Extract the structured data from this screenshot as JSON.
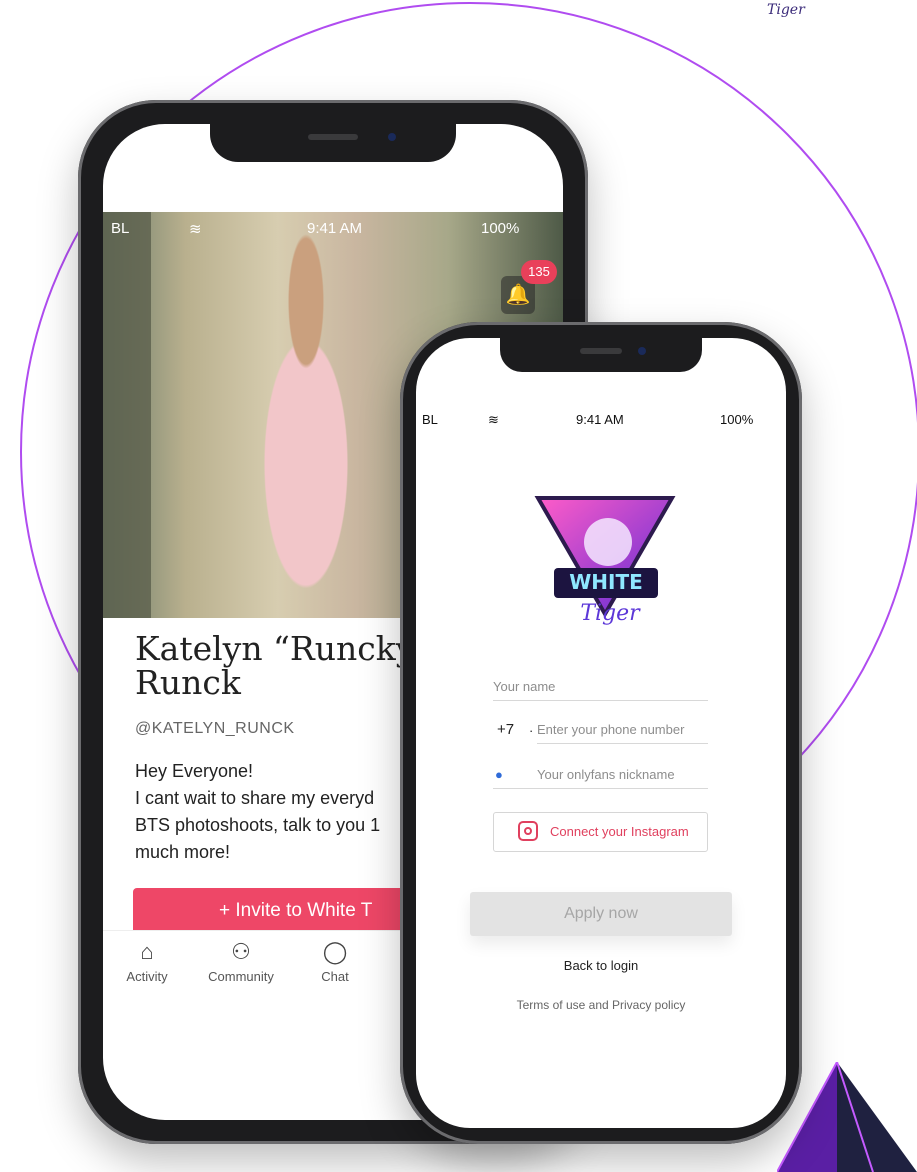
{
  "brand": {
    "name": "White Tiger",
    "accent": "#ee4767",
    "circle": "#b04cf0"
  },
  "phone1": {
    "status": {
      "carrier": "BL",
      "time": "9:41 AM",
      "battery": "100%"
    },
    "notifications": {
      "count": "135"
    },
    "profile": {
      "name": "Katelyn “Runcky”\nRunck",
      "handle": "@KATELYN_RUNCK",
      "bio": "Hey Everyone!\nI cant wait to share my everyd\nBTS photoshoots, talk to you 1\nmuch more!"
    },
    "invite_label": "+ Invite to White T",
    "tabs": [
      {
        "label": "Activity",
        "icon": "home-icon"
      },
      {
        "label": "Community",
        "icon": "users-icon"
      },
      {
        "label": "Chat",
        "icon": "chat-icon"
      }
    ]
  },
  "phone2": {
    "status": {
      "carrier": "BL",
      "time": "9:41 AM",
      "battery": "100%"
    },
    "logo_text": "WHITE Tiger",
    "form": {
      "name_placeholder": "Your name",
      "phone_prefix": "+7",
      "phone_placeholder": "Enter your phone number",
      "nickname_placeholder": "Your onlyfans nickname",
      "instagram_label": "Connect your Instagram",
      "apply_label": "Apply now"
    },
    "back_label": "Back to login",
    "terms_label": "Terms of use and Privacy policy"
  }
}
